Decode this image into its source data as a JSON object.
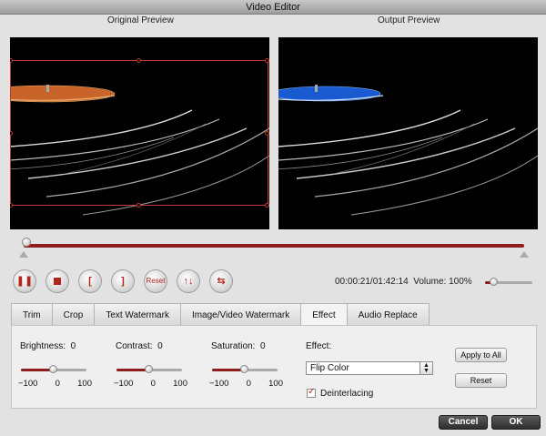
{
  "window": {
    "title": "Video Editor"
  },
  "previews": {
    "original_label": "Original Preview",
    "output_label": "Output Preview"
  },
  "playback": {
    "position": 0.0,
    "controls": [
      "pause-icon",
      "stop-icon",
      "mark-in-icon",
      "mark-out-icon",
      "Reset",
      "flip-vertical-icon",
      "swap-icon"
    ],
    "reset_label": "Reset",
    "time": "00:00:21/01:42:14",
    "volume_label": "Volume:",
    "volume_value": "100%",
    "volume_level": 0.2
  },
  "tabs": [
    "Trim",
    "Crop",
    "Text Watermark",
    "Image/Video Watermark",
    "Effect",
    "Audio Replace"
  ],
  "active_tab": "Effect",
  "effect_panel": {
    "brightness": {
      "label": "Brightness:",
      "value": "0",
      "level": 0.5,
      "min": "−100",
      "mid": "0",
      "max": "100"
    },
    "contrast": {
      "label": "Contrast:",
      "value": "0",
      "level": 0.5,
      "min": "−100",
      "mid": "0",
      "max": "100"
    },
    "saturation": {
      "label": "Saturation:",
      "value": "0",
      "level": 0.5,
      "min": "−100",
      "mid": "0",
      "max": "100"
    },
    "effect_label": "Effect:",
    "effect_value": "Flip Color",
    "deinterlacing_label": "Deinterlacing",
    "deinterlacing_checked": true,
    "apply_all_label": "Apply to All",
    "reset_label": "Reset"
  },
  "footer": {
    "cancel_label": "Cancel",
    "ok_label": "OK"
  },
  "colors": {
    "accent": "#b3241c",
    "slider_fill": "#8e1d1d",
    "orange_disc": "#c8642a",
    "blue_disc": "#1a5ad0"
  }
}
